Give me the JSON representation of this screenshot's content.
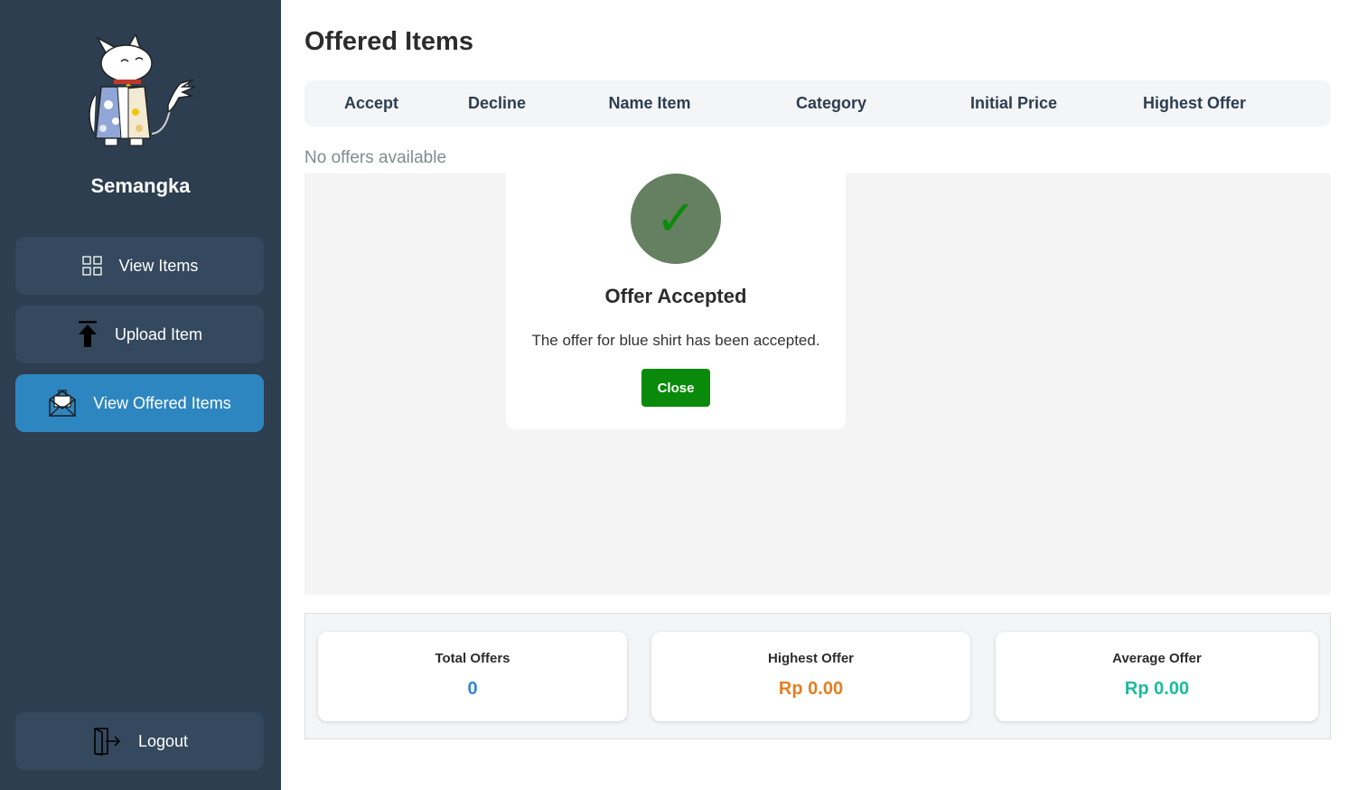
{
  "sidebar": {
    "username": "Semangka",
    "nav": {
      "view_items": "View Items",
      "upload_item": "Upload Item",
      "view_offered_items": "View Offered Items",
      "logout": "Logout"
    }
  },
  "main": {
    "title": "Offered Items",
    "table": {
      "columns": [
        "Accept",
        "Decline",
        "Name Item",
        "Category",
        "Initial Price",
        "Highest Offer"
      ]
    },
    "empty_message": "No offers available",
    "stats": [
      {
        "label": "Total Offers",
        "value": "0",
        "color": "#2e86de"
      },
      {
        "label": "Highest Offer",
        "value": "Rp 0.00",
        "color": "#e67e22"
      },
      {
        "label": "Average Offer",
        "value": "Rp 0.00",
        "color": "#1abc9c"
      }
    ]
  },
  "modal": {
    "title": "Offer Accepted",
    "message": "The offer for blue shirt has been accepted.",
    "close_label": "Close",
    "icon": "check-icon",
    "check_glyph": "✓"
  },
  "colors": {
    "sidebar_bg": "#2c3e50",
    "nav_button_bg": "#34495e",
    "nav_active_bg": "#2e86c1",
    "success_green": "#0a8a0a"
  }
}
